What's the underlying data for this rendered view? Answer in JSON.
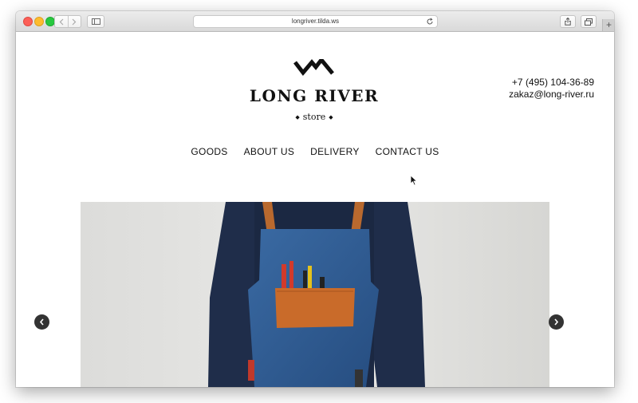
{
  "browser": {
    "url": "longriver.tilda.ws",
    "icons": {
      "back": "chevron-left-icon",
      "forward": "chevron-right-icon",
      "sidebar": "sidebar-icon",
      "reload": "reload-icon",
      "share": "share-icon",
      "tabs": "tabs-overview-icon",
      "new_tab": "plus-icon"
    },
    "new_tab_label": "+"
  },
  "header": {
    "brand_name": "LONG RIVER",
    "brand_sub": "store",
    "phone": "+7 (495) 104-36-89",
    "email": "zakaz@long-river.ru"
  },
  "menu": {
    "items": [
      {
        "label": "GOODS"
      },
      {
        "label": "ABOUT US"
      },
      {
        "label": "DELIVERY"
      },
      {
        "label": "CONTACT US"
      }
    ]
  },
  "slider": {
    "prev_icon": "chevron-left-icon",
    "next_icon": "chevron-right-icon"
  },
  "colors": {
    "text": "#111111",
    "apron": "#2e5c94",
    "pocket": "#c96b2a",
    "sweater": "#1c2a44",
    "arrow_bg": "#333333"
  }
}
